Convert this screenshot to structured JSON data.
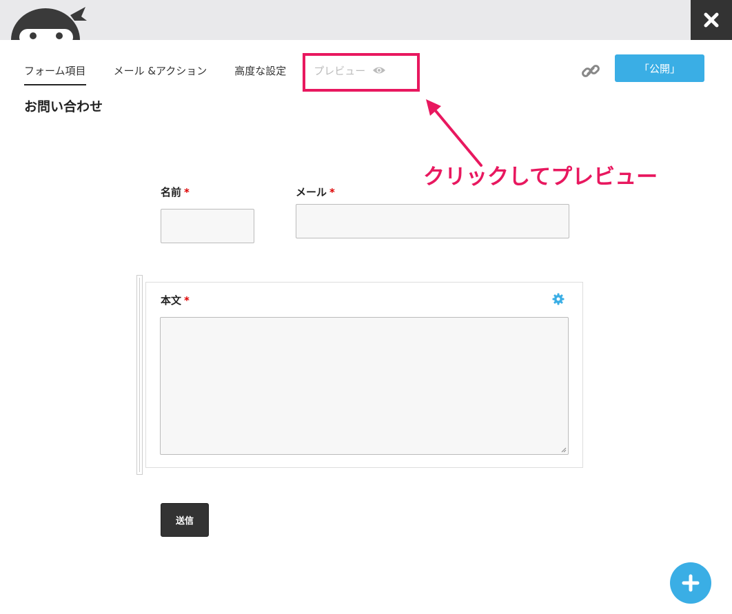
{
  "header": {
    "close_icon": "close-icon"
  },
  "tabs": [
    {
      "label": "フォーム項目",
      "active": true
    },
    {
      "label": "メール &アクション",
      "active": false
    },
    {
      "label": "高度な設定",
      "active": false
    },
    {
      "label": "プレビュー",
      "active": false,
      "disabled": true,
      "icon": "eye-icon"
    }
  ],
  "toolbar": {
    "link_icon": "link-icon",
    "publish_label": "「公開」"
  },
  "form": {
    "title": "お問い合わせ",
    "fields": {
      "name_label": "名前",
      "email_label": "メール",
      "body_label": "本文",
      "required_mark": "*"
    },
    "submit_label": "送信"
  },
  "annotation": {
    "text": "クリックしてプレビュー",
    "color": "#e8185f"
  },
  "colors": {
    "accent": "#3aaee5",
    "highlight": "#e8185f",
    "dark": "#333333"
  }
}
